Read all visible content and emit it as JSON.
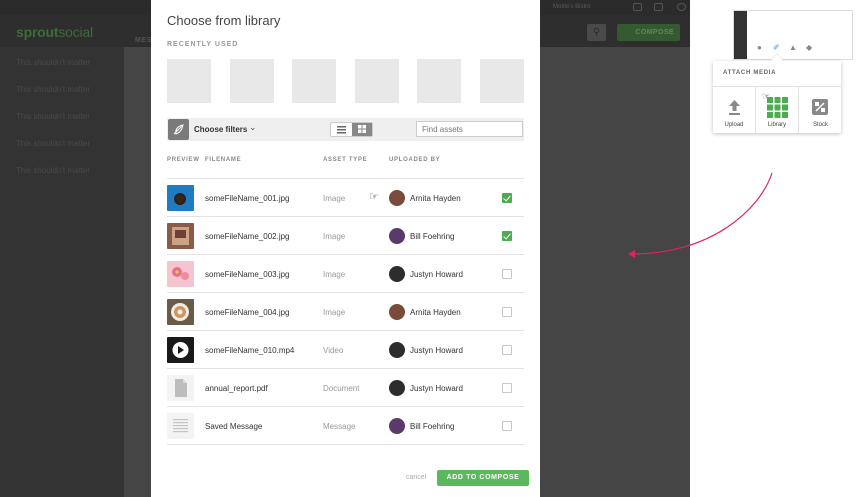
{
  "background": {
    "logo_bold": "sprout",
    "logo_light": "social",
    "nav_partial": "MES",
    "account_name": "Mottie's Bistro",
    "compose_label": "COMPOSE",
    "sidebar_items": [
      "This shouldn't matter",
      "This shouldn't matter",
      "This shouldn't matter",
      "This shouldn't matter",
      "This shouldn't matter"
    ]
  },
  "modal": {
    "title": "Choose from library",
    "recently_used_label": "RECENTLY USED",
    "toolbar": {
      "filter_label": "Choose filters",
      "search_placeholder": "Find assets"
    },
    "columns": {
      "preview": "PREVIEW",
      "filename": "FILENAME",
      "asset_type": "ASSET TYPE",
      "uploaded_by": "UPLOADED BY"
    },
    "rows": [
      {
        "filename": "someFileName_001.jpg",
        "type": "Image",
        "uploader": "Arnita Hayden",
        "checked": true
      },
      {
        "filename": "someFileName_002.jpg",
        "type": "Image",
        "uploader": "Bill Foehring",
        "checked": true
      },
      {
        "filename": "someFileName_003.jpg",
        "type": "Image",
        "uploader": "Justyn Howard",
        "checked": false
      },
      {
        "filename": "someFileName_004.jpg",
        "type": "Image",
        "uploader": "Arnita Hayden",
        "checked": false
      },
      {
        "filename": "someFileName_010.mp4",
        "type": "Video",
        "uploader": "Justyn Howard",
        "checked": false
      },
      {
        "filename": "annual_report.pdf",
        "type": "Document",
        "uploader": "Justyn Howard",
        "checked": false
      },
      {
        "filename": "Saved Message",
        "type": "Message",
        "uploader": "Bill Foehring",
        "checked": false
      }
    ],
    "footer": {
      "cancel_label": "cancel",
      "add_label": "ADD TO COMPOSE"
    }
  },
  "attach_media": {
    "title": "ATTACH MEDIA",
    "options": [
      {
        "label": "Upload",
        "icon": "upload-arrow-icon"
      },
      {
        "label": "Library",
        "icon": "grid-icon"
      },
      {
        "label": "Stock",
        "icon": "stock-image-icon"
      }
    ]
  },
  "colors": {
    "accent_green": "#5cb85c",
    "checkbox_green": "#4dac51",
    "arrow_pink": "#e0245e"
  }
}
